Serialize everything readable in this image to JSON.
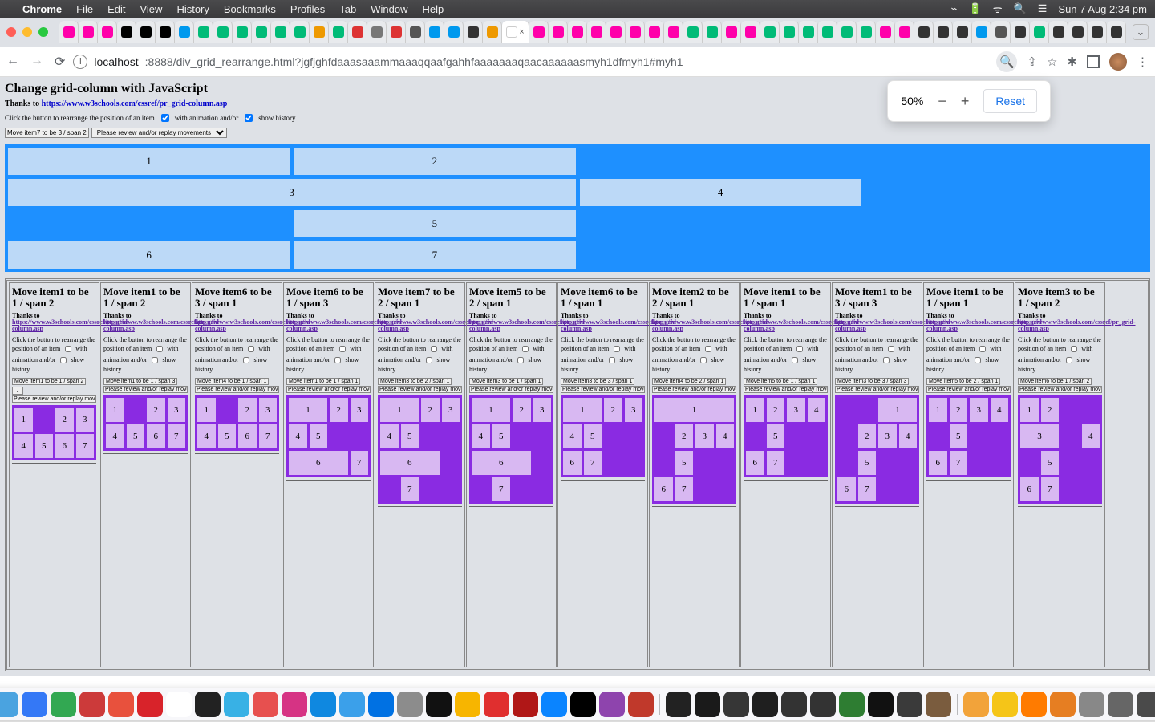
{
  "menubar": {
    "app": "Chrome",
    "items": [
      "File",
      "Edit",
      "View",
      "History",
      "Bookmarks",
      "Profiles",
      "Tab",
      "Window",
      "Help"
    ],
    "right": {
      "clock": "Sun 7 Aug  2:34 pm"
    }
  },
  "omnibox": {
    "host": "localhost",
    "port_path": ":8888/div_grid_rearrange.html?jgfjghfdaaasaaammaaaqqaafgahhfaaaaaaaqaacaaaaaasmyh1dfmyh1#myh1"
  },
  "zoom": {
    "value": "50%",
    "reset": "Reset"
  },
  "page": {
    "title": "Change grid-column with JavaScript",
    "thanks_label": "Thanks to ",
    "thanks_url": "https://www.w3schools.com/cssref/pr_grid-column.asp",
    "instr_a": "Click the button to rearrange the position of an item",
    "instr_b": "with animation and/or",
    "instr_c": "show history",
    "btn": "Move item7 to be 3 / span 2",
    "sel": "Please review and/or replay movements"
  },
  "biggrid": [
    {
      "n": "1",
      "col": "1",
      "span": 2
    },
    {
      "n": "2",
      "col": "3",
      "span": 2
    },
    {
      "n": "3",
      "col": "1",
      "span": 4
    },
    {
      "n": "4",
      "col": "5",
      "span": 2
    },
    {
      "n": "5",
      "col": "3",
      "span": 2
    },
    {
      "n": "6",
      "col": "1",
      "span": 2
    },
    {
      "n": "7",
      "col": "3",
      "span": 2
    }
  ],
  "panel_defaults": {
    "thanks_label": "Thanks to ",
    "thanks_url": "https://www.w3schools.com/cssref/pr_grid-column.asp",
    "instr_a": "Click the button to rearrange the position of an item",
    "instr_b": "with animation and/or",
    "instr_c": "show history",
    "sel": "Please review and/or replay movemt"
  },
  "panels": [
    {
      "title": "Move item1 to be 1 / span 2",
      "btn": "Move item1 to be 1 / span 2",
      "extra_sel": true,
      "cells": [
        {
          "n": "1",
          "c": 1,
          "s": 1
        },
        {
          "n": "2",
          "c": 3,
          "s": 1
        },
        {
          "n": "3",
          "c": 4,
          "s": 1
        },
        {
          "n": "4",
          "c": 1,
          "s": 1
        },
        {
          "n": "5",
          "c": 2,
          "s": 1
        },
        {
          "n": "6",
          "c": 3,
          "s": 1
        },
        {
          "n": "7",
          "c": 4,
          "s": 1
        }
      ]
    },
    {
      "title": "Move item1 to be 1 / span 2",
      "btn": "Move item1 to be 1 / span 3",
      "cells": [
        {
          "n": "1",
          "c": 1,
          "s": 1
        },
        {
          "n": "2",
          "c": 3,
          "s": 1
        },
        {
          "n": "3",
          "c": 4,
          "s": 1
        },
        {
          "n": "4",
          "c": 1,
          "s": 1
        },
        {
          "n": "5",
          "c": 2,
          "s": 1
        },
        {
          "n": "6",
          "c": 3,
          "s": 1
        },
        {
          "n": "7",
          "c": 4,
          "s": 1
        }
      ]
    },
    {
      "title": "Move item6 to be 3 / span 1",
      "btn": "Move item4 to be 1 / span 1",
      "cells": [
        {
          "n": "1",
          "c": 1,
          "s": 1
        },
        {
          "n": "2",
          "c": 3,
          "s": 1
        },
        {
          "n": "3",
          "c": 4,
          "s": 1
        },
        {
          "n": "4",
          "c": 1,
          "s": 1
        },
        {
          "n": "5",
          "c": 2,
          "s": 1
        },
        {
          "n": "6",
          "c": 3,
          "s": 1
        },
        {
          "n": "7",
          "c": 4,
          "s": 1
        }
      ]
    },
    {
      "title": "Move item6 to be 1 / span 3",
      "btn": "Move item1 to be 1 / span 1",
      "cells": [
        {
          "n": "1",
          "c": 1,
          "s": 2
        },
        {
          "n": "2",
          "c": 3,
          "s": 1
        },
        {
          "n": "3",
          "c": 4,
          "s": 1
        },
        {
          "n": "4",
          "c": 1,
          "s": 1
        },
        {
          "n": "5",
          "c": 2,
          "s": 1
        },
        {
          "n": "6",
          "c": 1,
          "s": 3
        },
        {
          "n": "7",
          "c": 4,
          "s": 1
        }
      ]
    },
    {
      "title": "Move item7 to be 2 / span 1",
      "btn": "Move item3 to be 2 / span 1",
      "cells": [
        {
          "n": "1",
          "c": 1,
          "s": 2
        },
        {
          "n": "2",
          "c": 3,
          "s": 1
        },
        {
          "n": "3",
          "c": 4,
          "s": 1
        },
        {
          "n": "4",
          "c": 1,
          "s": 1
        },
        {
          "n": "5",
          "c": 2,
          "s": 1
        },
        {
          "n": "6",
          "c": 1,
          "s": 3
        },
        {
          "n": "7",
          "c": 2,
          "s": 1
        }
      ]
    },
    {
      "title": "Move item5 to be 2 / span 1",
      "btn": "Move item3 to be 1 / span 1",
      "cells": [
        {
          "n": "1",
          "c": 1,
          "s": 2
        },
        {
          "n": "2",
          "c": 3,
          "s": 1
        },
        {
          "n": "3",
          "c": 4,
          "s": 1
        },
        {
          "n": "4",
          "c": 1,
          "s": 1
        },
        {
          "n": "5",
          "c": 2,
          "s": 1
        },
        {
          "n": "6",
          "c": 1,
          "s": 3
        },
        {
          "n": "7",
          "c": 2,
          "s": 1
        }
      ]
    },
    {
      "title": "Move item6 to be 1 / span 1",
      "btn": "Move item3 to be 3 / span 1",
      "cells": [
        {
          "n": "1",
          "c": 1,
          "s": 2
        },
        {
          "n": "2",
          "c": 3,
          "s": 1
        },
        {
          "n": "3",
          "c": 4,
          "s": 1
        },
        {
          "n": "4",
          "c": 1,
          "s": 1
        },
        {
          "n": "5",
          "c": 2,
          "s": 1
        },
        {
          "n": "6",
          "c": 1,
          "s": 1
        },
        {
          "n": "7",
          "c": 2,
          "s": 1
        }
      ]
    },
    {
      "title": "Move item2 to be 2 / span 1",
      "btn": "Move item4 to be 2 / span 1",
      "cells": [
        {
          "n": "1",
          "c": 1,
          "s": 4
        },
        {
          "n": "2",
          "c": 2,
          "s": 1
        },
        {
          "n": "3",
          "c": 3,
          "s": 1
        },
        {
          "n": "4",
          "c": 4,
          "s": 1
        },
        {
          "n": "5",
          "c": 2,
          "s": 1
        },
        {
          "n": "6",
          "c": 1,
          "s": 1
        },
        {
          "n": "7",
          "c": 2,
          "s": 1
        }
      ]
    },
    {
      "title": "Move item1 to be 1 / span 1",
      "btn": "Move item5 to be 1 / span 1",
      "cells": [
        {
          "n": "1",
          "c": 1,
          "s": 1
        },
        {
          "n": "2",
          "c": 2,
          "s": 1
        },
        {
          "n": "3",
          "c": 3,
          "s": 1
        },
        {
          "n": "4",
          "c": 4,
          "s": 1
        },
        {
          "n": "5",
          "c": 2,
          "s": 1
        },
        {
          "n": "6",
          "c": 1,
          "s": 1
        },
        {
          "n": "7",
          "c": 2,
          "s": 1
        }
      ]
    },
    {
      "title": "Move item1 to be 3 / span 3",
      "btn": "Move item3 to be 3 / span 3",
      "cells": [
        {
          "n": "1",
          "c": 3,
          "s": 2
        },
        {
          "n": "2",
          "c": 2,
          "s": 1
        },
        {
          "n": "3",
          "c": 3,
          "s": 1
        },
        {
          "n": "4",
          "c": 4,
          "s": 1
        },
        {
          "n": "5",
          "c": 2,
          "s": 1
        },
        {
          "n": "6",
          "c": 1,
          "s": 1
        },
        {
          "n": "7",
          "c": 2,
          "s": 1
        }
      ]
    },
    {
      "title": "Move item1 to be 1 / span 1",
      "btn": "Move item5 to be 2 / span 1",
      "cells": [
        {
          "n": "1",
          "c": 1,
          "s": 1
        },
        {
          "n": "2",
          "c": 2,
          "s": 1
        },
        {
          "n": "3",
          "c": 3,
          "s": 1
        },
        {
          "n": "4",
          "c": 4,
          "s": 1
        },
        {
          "n": "5",
          "c": 2,
          "s": 1
        },
        {
          "n": "6",
          "c": 1,
          "s": 1
        },
        {
          "n": "7",
          "c": 2,
          "s": 1
        }
      ]
    },
    {
      "title": "Move item3 to be 1 / span 2",
      "btn": "Move item6 to be 1 / span 2",
      "cells": [
        {
          "n": "1",
          "c": 1,
          "s": 1
        },
        {
          "n": "2",
          "c": 2,
          "s": 1
        },
        {
          "n": "3",
          "c": 1,
          "s": 2
        },
        {
          "n": "4",
          "c": 4,
          "s": 1
        },
        {
          "n": "5",
          "c": 2,
          "s": 1
        },
        {
          "n": "6",
          "c": 1,
          "s": 1
        },
        {
          "n": "7",
          "c": 2,
          "s": 1
        }
      ]
    }
  ],
  "tabs": {
    "favicons": [
      "#f0a",
      "#f0a",
      "#f0a",
      "#000",
      "#000",
      "#000",
      "#09e",
      "#0b7",
      "#0b7",
      "#0b7",
      "#0b7",
      "#0b7",
      "#0b7",
      "#e90",
      "#0b7",
      "#d33",
      "#777",
      "#d33",
      "#555",
      "#09e",
      "#09e",
      "#333",
      "#e90",
      "#fff",
      "#f0a",
      "#f0a",
      "#f0a",
      "#f0a",
      "#f0a",
      "#f0a",
      "#f0a",
      "#f0a",
      "#0b7",
      "#0b7",
      "#f0a",
      "#f0a",
      "#0b7",
      "#0b7",
      "#0b7",
      "#0b7",
      "#0b7",
      "#0b7",
      "#f0a",
      "#f0a",
      "#333",
      "#333",
      "#333",
      "#09e",
      "#555",
      "#333",
      "#0b7"
    ],
    "active_index": 23,
    "post": [
      "#333",
      "#333",
      "#333",
      "#333",
      "#e90"
    ]
  },
  "dock_colors": [
    "#2b6fdc",
    "#e58b2a",
    "#4aa3e0",
    "#3478f6",
    "#32a852",
    "#cc3a3a",
    "#e8513d",
    "#d8232a",
    "#ffffff",
    "#222",
    "#38b1e5",
    "#e7504f",
    "#d63384",
    "#0f88e0",
    "#3ba0ea",
    "#0071e3",
    "#8c8c8c",
    "#111",
    "#f7b500",
    "#e02f2f",
    "#b01717",
    "#0a84ff",
    "#000",
    "#8e44ad",
    "#c0392b",
    "#222",
    "#1a1a1a",
    "#363636",
    "#1f1f1f",
    "#333",
    "#333",
    "#2e7d32",
    "#111",
    "#3a3a3a",
    "#7a5c3e",
    "#f2a33a",
    "#f5c518",
    "#ff7b00",
    "#e67e22",
    "#888",
    "#666",
    "#4a4a4a",
    "#3a6ea5",
    "#2a2a2a"
  ]
}
